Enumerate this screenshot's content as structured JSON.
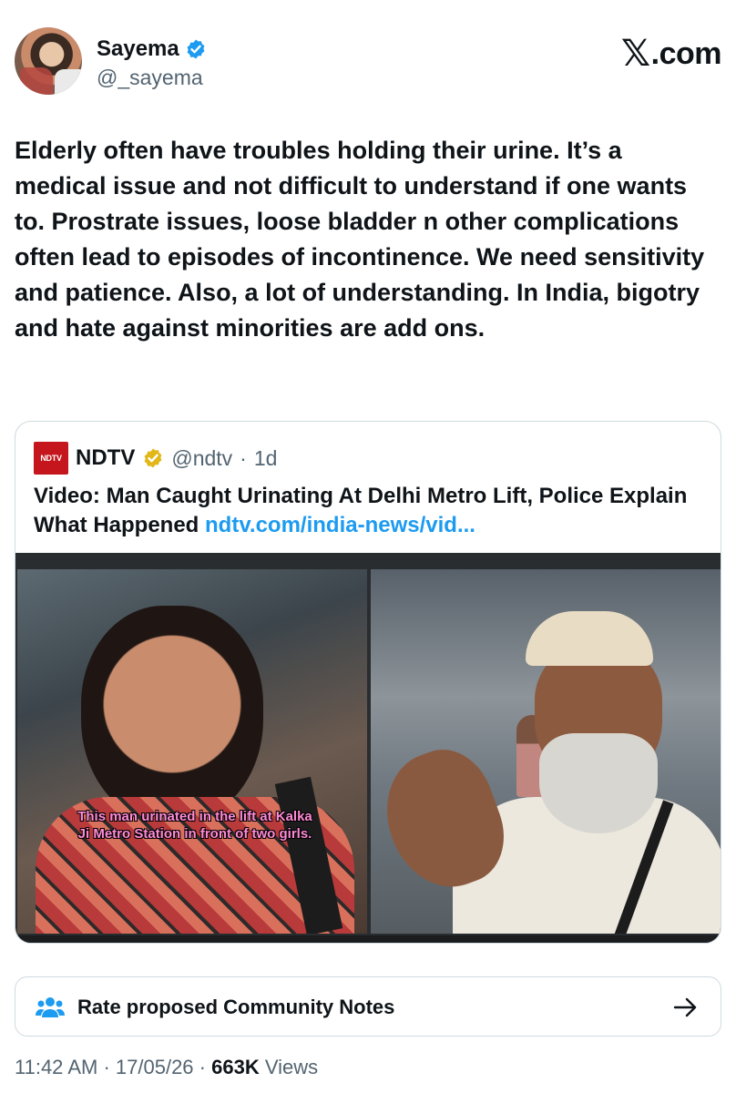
{
  "author": {
    "name": "Sayema",
    "handle": "@_sayema"
  },
  "brand": {
    "x_glyph": "𝕏",
    "domain": ".com"
  },
  "tweet": {
    "text": "Elderly often have troubles holding their urine. It’s a medical issue and not difficult to understand if one wants to. Prostrate issues, loose bladder n other complications often lead to episodes of incontinence. We need sensitivity and patience. Also, a lot of understanding. In India, bigotry and hate against minorities are add ons."
  },
  "quoted": {
    "logo_text": "NDTV",
    "name": "NDTV",
    "handle": "@ndtv",
    "separator": "·",
    "age": "1d",
    "title": "Video: Man Caught Urinating At Delhi Metro Lift, Police Explain What Happened",
    "link": "ndtv.com/india-news/vid...",
    "media_caption": "This man urinated in the lift at Kalka Ji Metro Station in front of two girls."
  },
  "community_notes": {
    "label": "Rate proposed Community Notes"
  },
  "meta": {
    "time": "11:42 AM",
    "separator": "·",
    "date": "17/05/26",
    "views_count": "663K",
    "views_label": "Views"
  },
  "colors": {
    "verified_blue": "#1d9bf0",
    "verified_gold": "#e2b719",
    "link": "#1d9bf0",
    "ndtv_red": "#c4161c"
  }
}
